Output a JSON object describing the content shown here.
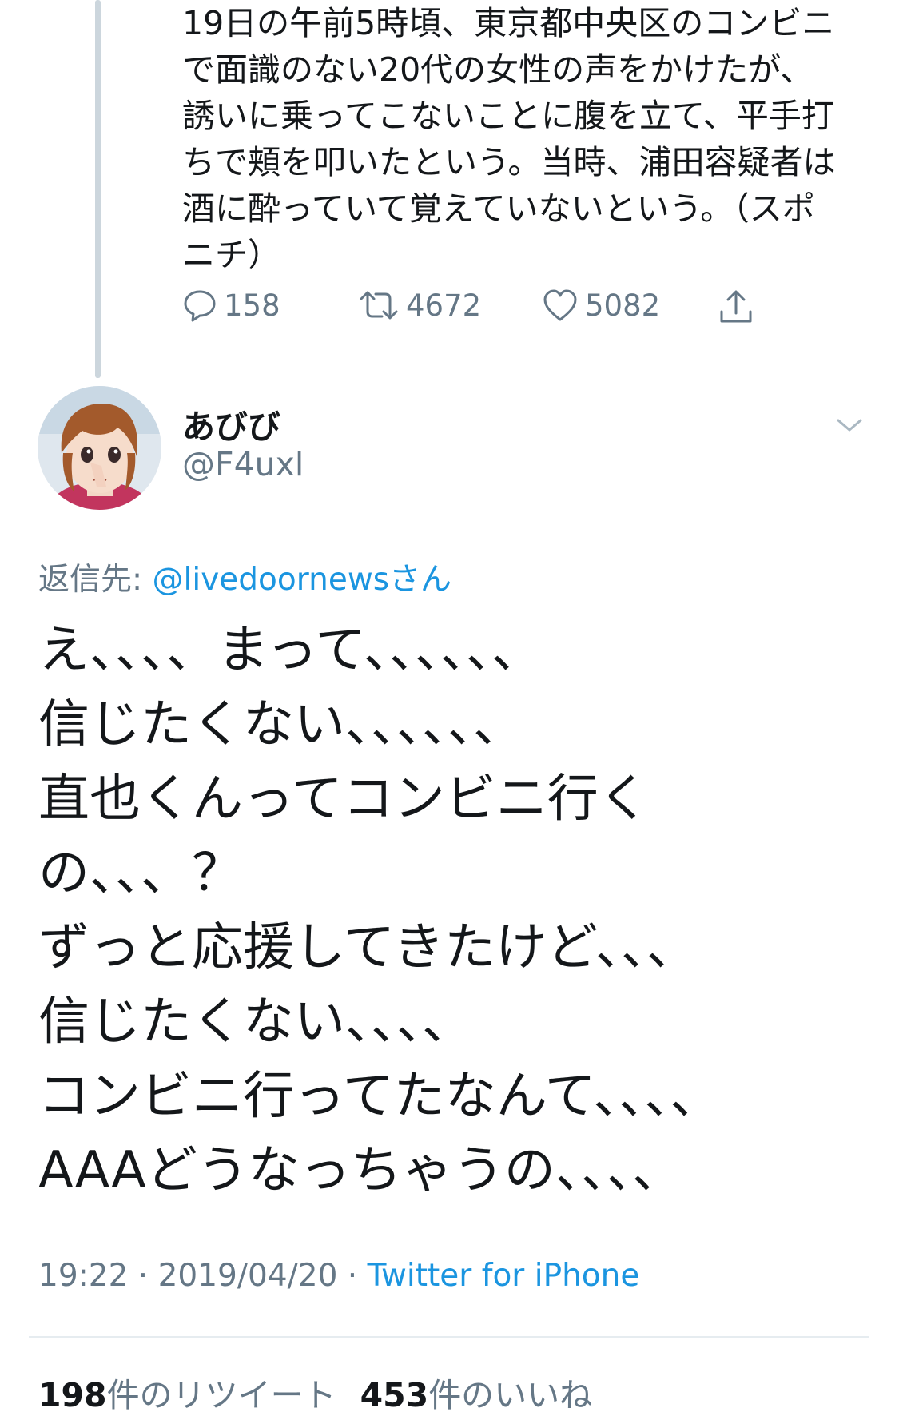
{
  "quoted_tweet": {
    "text": "19日の午前5時頃、東京都中央区のコンビニ\nで面識のない20代の女性の声をかけたが、\n誘いに乗ってこないことに腹を立て、平手打\nちで頬を叩いたという。当時、浦田容疑者は\n酒に酔っていて覚えていないという。（スポ\nニチ）",
    "reply_count": "158",
    "retweet_count": "4672",
    "like_count": "5082"
  },
  "tweet": {
    "user_name": "あびび",
    "user_handle": "@F4uxl",
    "reply_prefix": "返信先: ",
    "reply_mention": "@livedoornewsさん",
    "body": "え、、、、まって、、、、、、\n信じたくない、、、、、、\n直也くんってコンビニ行く\nの、、、？\nずっと応援してきたけど、、、\n信じたくない、、、、\nコンビニ行ってたなんて、、、、\nAAAどうなっちゃうの、、、、",
    "time": "19:22",
    "date": "2019/04/20",
    "separator": " · ",
    "source": "Twitter for iPhone",
    "retweet_number": "198",
    "retweet_label": "件のリツイート",
    "like_number": "453",
    "like_label": "件のいいね"
  },
  "icons": {
    "reply": "reply-icon",
    "retweet": "retweet-icon",
    "like": "heart-icon",
    "share": "share-icon",
    "more": "chevron-down-icon"
  }
}
